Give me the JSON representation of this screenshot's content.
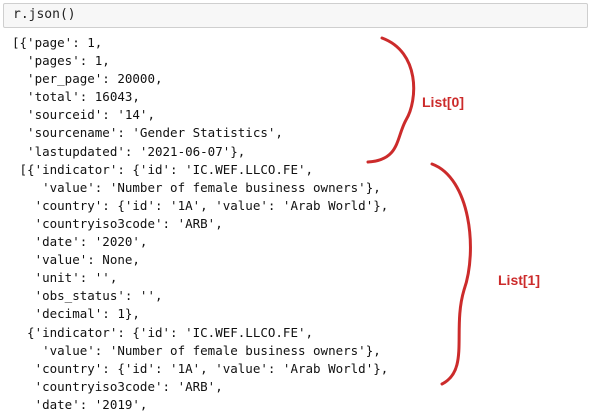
{
  "notebook": {
    "cell_input": "r.json()",
    "output_lines": [
      "[{'page': 1,",
      "  'pages': 1,",
      "  'per_page': 20000,",
      "  'total': 16043,",
      "  'sourceid': '14',",
      "  'sourcename': 'Gender Statistics',",
      "  'lastupdated': '2021-06-07'},",
      " [{'indicator': {'id': 'IC.WEF.LLCO.FE',",
      "    'value': 'Number of female business owners'},",
      "   'country': {'id': '1A', 'value': 'Arab World'},",
      "   'countryiso3code': 'ARB',",
      "   'date': '2020',",
      "   'value': None,",
      "   'unit': '',",
      "   'obs_status': '',",
      "   'decimal': 1},",
      "  {'indicator': {'id': 'IC.WEF.LLCO.FE',",
      "    'value': 'Number of female business owners'},",
      "   'country': {'id': '1A', 'value': 'Arab World'},",
      "   'countryiso3code': 'ARB',",
      "   'date': '2019',"
    ]
  },
  "annotations": {
    "list0_label": "List[0]",
    "list1_label": "List[1]",
    "color": "#cc2b2b"
  }
}
